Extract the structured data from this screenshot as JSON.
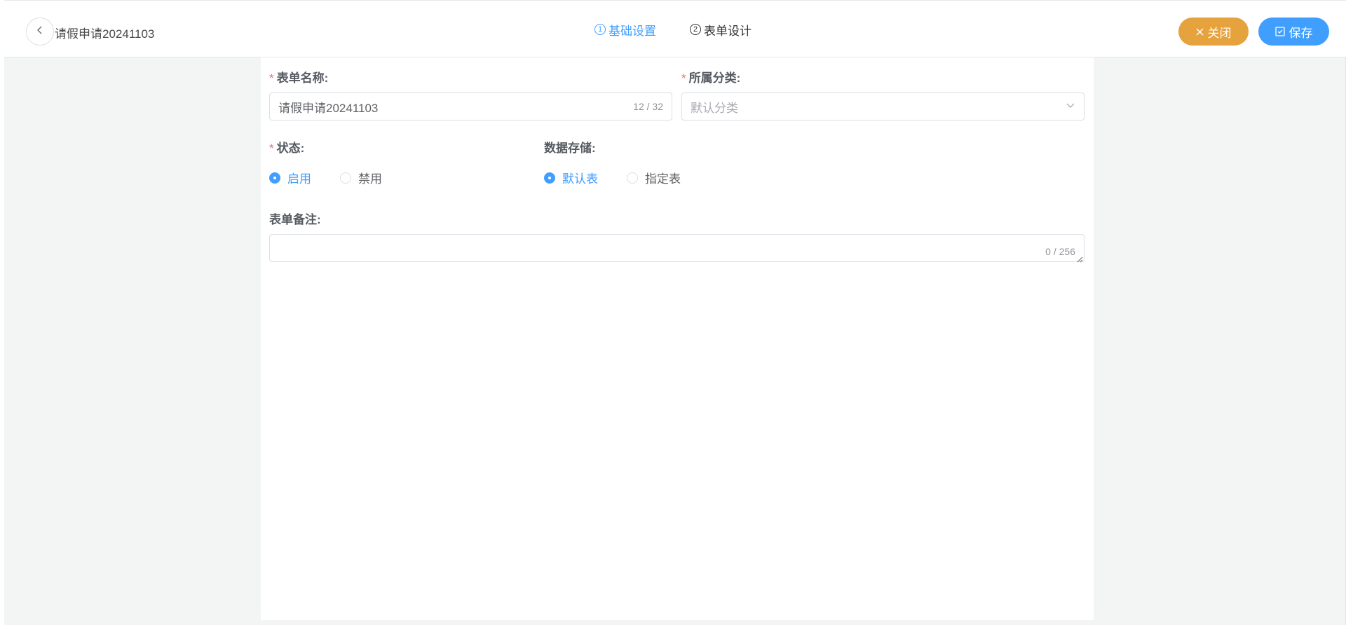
{
  "header": {
    "title": "请假申请20241103",
    "steps": [
      {
        "num": "1",
        "label": "基础设置",
        "active": true
      },
      {
        "num": "2",
        "label": "表单设计",
        "active": false
      }
    ],
    "close_label": "关闭",
    "save_label": "保存"
  },
  "form": {
    "name": {
      "label": "表单名称:",
      "value": "请假申请20241103",
      "count": "12 / 32"
    },
    "category": {
      "label": "所属分类:",
      "placeholder": "默认分类"
    },
    "status": {
      "label": "状态:",
      "options": [
        "启用",
        "禁用"
      ],
      "selected": "启用"
    },
    "storage": {
      "label": "数据存储:",
      "options": [
        "默认表",
        "指定表"
      ],
      "selected": "默认表"
    },
    "remark": {
      "label": "表单备注:",
      "value": "",
      "count": "0 / 256"
    }
  },
  "colors": {
    "primary": "#409eff",
    "warning": "#e6a23c",
    "required": "#f56c6c"
  }
}
